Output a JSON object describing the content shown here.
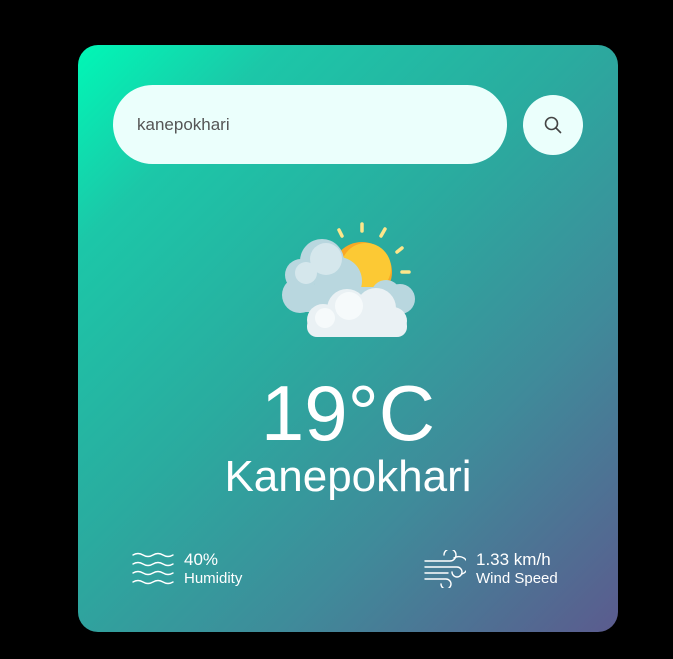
{
  "search": {
    "value": "kanepokhari",
    "icon": "search-icon"
  },
  "weather": {
    "icon": "partly-cloudy-icon",
    "temperature": "19°C",
    "city": "Kanepokhari"
  },
  "details": {
    "humidity": {
      "icon": "humidity-waves-icon",
      "value": "40%",
      "label": "Humidity"
    },
    "wind": {
      "icon": "wind-icon",
      "value": "1.33 km/h",
      "label": "Wind Speed"
    }
  },
  "colors": {
    "card_gradient_start": "#00f8b6",
    "card_gradient_end": "#5b5b8e",
    "input_background": "#ebfffc",
    "text": "#ffffff",
    "sun": "#fbc02d"
  }
}
